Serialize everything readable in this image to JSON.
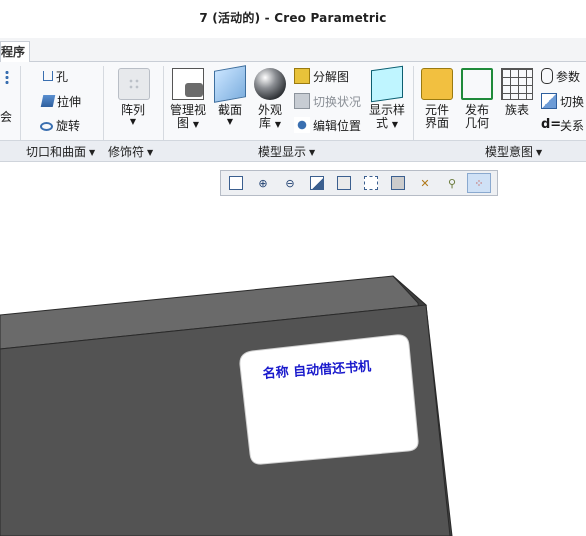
{
  "window": {
    "title": "7 (活动的) - Creo Parametric"
  },
  "tabs": {
    "app_tab": "程序"
  },
  "ribbon": {
    "cut_surface": {
      "hole": "孔",
      "extrude": "拉伸",
      "revolve": "旋转",
      "group_label": "切口和曲面"
    },
    "modifiers": {
      "pattern_l1": "阵列",
      "group_label": "修饰符"
    },
    "model_display": {
      "manage_view_l1": "管理视",
      "manage_view_l2": "图",
      "section": "截面",
      "appearance_l1": "外观",
      "appearance_l2": "库",
      "exploded_view": "分解图",
      "toggle_status": "切换状况",
      "edit_position": "编辑位置",
      "display_style_l1": "显示样",
      "display_style_l2": "式",
      "group_label": "模型显示"
    },
    "model_intent": {
      "component_interface_l1": "元件",
      "component_interface_l2": "界面",
      "publish_geom_l1": "发布",
      "publish_geom_l2": "几何",
      "family_table": "族表",
      "parameters": "参数",
      "switch_dims": "切换",
      "relations": "关系",
      "group_label": "模型意图"
    },
    "left_partial": {
      "label": "会"
    }
  },
  "viewport": {
    "part_label": "名称  自动借还书机"
  },
  "colors": {
    "part_body": "#535353",
    "part_edge": "#2a2a2a",
    "label_text": "#1a1acc",
    "label_bg": "#ffffff"
  }
}
